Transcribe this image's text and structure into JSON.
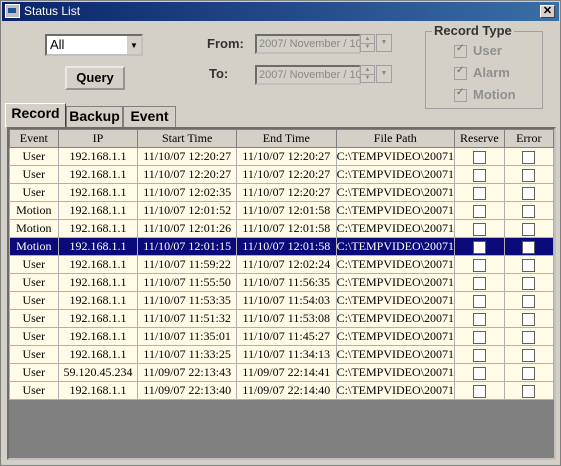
{
  "window": {
    "title": "Status List",
    "close": "✕"
  },
  "filter": {
    "selected": "All"
  },
  "query_label": "Query",
  "from": {
    "label": "From:",
    "value": "2007/ November / 10"
  },
  "to": {
    "label": "To:",
    "value": "2007/ November / 10"
  },
  "record_type": {
    "title": "Record Type",
    "items": [
      {
        "label": "User",
        "checked": true
      },
      {
        "label": "Alarm",
        "checked": true
      },
      {
        "label": "Motion",
        "checked": true
      }
    ]
  },
  "tabs": [
    "Record",
    "Backup",
    "Event"
  ],
  "active_tab": "Record",
  "table": {
    "columns": [
      "Event",
      "IP",
      "Start Time",
      "End Time",
      "File Path",
      "Reserve",
      "Error"
    ],
    "rows": [
      [
        "User",
        "192.168.1.1",
        "11/10/07 12:20:27",
        "11/10/07 12:20:27",
        "C:\\TEMPVIDEO\\20071"
      ],
      [
        "User",
        "192.168.1.1",
        "11/10/07 12:20:27",
        "11/10/07 12:20:27",
        "C:\\TEMPVIDEO\\20071"
      ],
      [
        "User",
        "192.168.1.1",
        "11/10/07 12:02:35",
        "11/10/07 12:20:27",
        "C:\\TEMPVIDEO\\20071"
      ],
      [
        "Motion",
        "192.168.1.1",
        "11/10/07 12:01:52",
        "11/10/07 12:01:58",
        "C:\\TEMPVIDEO\\20071"
      ],
      [
        "Motion",
        "192.168.1.1",
        "11/10/07 12:01:26",
        "11/10/07 12:01:58",
        "C:\\TEMPVIDEO\\20071"
      ],
      [
        "Motion",
        "192.168.1.1",
        "11/10/07 12:01:15",
        "11/10/07 12:01:58",
        "C:\\TEMPVIDEO\\20071"
      ],
      [
        "User",
        "192.168.1.1",
        "11/10/07 11:59:22",
        "11/10/07 12:02:24",
        "C:\\TEMPVIDEO\\20071"
      ],
      [
        "User",
        "192.168.1.1",
        "11/10/07 11:55:50",
        "11/10/07 11:56:35",
        "C:\\TEMPVIDEO\\20071"
      ],
      [
        "User",
        "192.168.1.1",
        "11/10/07 11:53:35",
        "11/10/07 11:54:03",
        "C:\\TEMPVIDEO\\20071"
      ],
      [
        "User",
        "192.168.1.1",
        "11/10/07 11:51:32",
        "11/10/07 11:53:08",
        "C:\\TEMPVIDEO\\20071"
      ],
      [
        "User",
        "192.168.1.1",
        "11/10/07 11:35:01",
        "11/10/07 11:45:27",
        "C:\\TEMPVIDEO\\20071"
      ],
      [
        "User",
        "192.168.1.1",
        "11/10/07 11:33:25",
        "11/10/07 11:34:13",
        "C:\\TEMPVIDEO\\20071"
      ],
      [
        "User",
        "59.120.45.234",
        "11/09/07 22:13:43",
        "11/09/07 22:14:41",
        "C:\\TEMPVIDEO\\20071"
      ],
      [
        "User",
        "192.168.1.1",
        "11/09/07 22:13:40",
        "11/09/07 22:14:40",
        "C:\\TEMPVIDEO\\20071"
      ]
    ],
    "selected_row": 5
  },
  "colors": {
    "titlebar": "#0a246a",
    "row_bg": "#fffbe6",
    "selected_row": "#0a0a7a"
  }
}
